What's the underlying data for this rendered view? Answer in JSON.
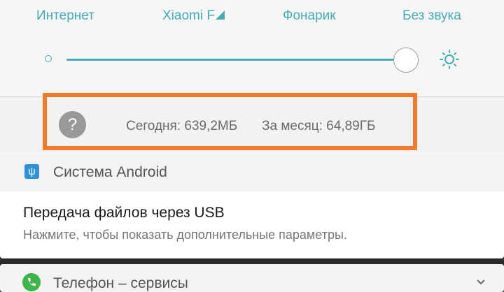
{
  "quick_settings": {
    "toggles": {
      "internet": "Интернет",
      "wifi": "Xiaomi F",
      "flashlight": "Фонарик",
      "silent": "Без звука"
    },
    "brightness_level": 0.97,
    "accent_color": "#49a9b4"
  },
  "data_usage": {
    "help_symbol": "?",
    "today": "Сегодня: 639,2МБ",
    "month": "За месяц: 64,89ГБ",
    "highlight_color": "#f4792b"
  },
  "notifications": [
    {
      "app_icon": "usb-icon",
      "app_name": "Система Android",
      "title": "Передача файлов через USB",
      "text": "Нажмите, чтобы показать дополнительные параметры."
    },
    {
      "app_icon": "phone-icon",
      "app_name": "Телефон – сервисы"
    }
  ]
}
